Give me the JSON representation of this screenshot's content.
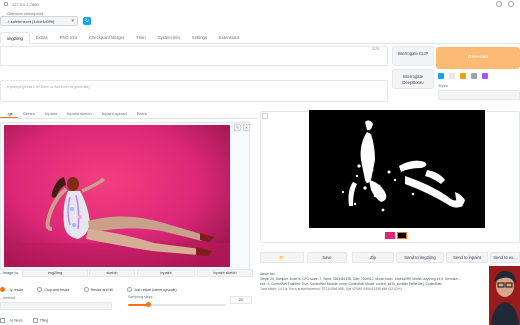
{
  "browser": {
    "url": "127.0.0.1:7860"
  },
  "checkpoint": {
    "label": "...Diffusion checkpoint",
    "value": "...t.safetensors [1dce4d0f9f]"
  },
  "tabs": [
    {
      "label": "img2img",
      "active": true
    },
    {
      "label": "Extras"
    },
    {
      "label": "PNG Info"
    },
    {
      "label": "Checkpoint Merger"
    },
    {
      "label": "Train"
    },
    {
      "label": "System Info"
    },
    {
      "label": "Settings"
    },
    {
      "label": "Extensions"
    }
  ],
  "prompt": {
    "counter": "2/75"
  },
  "negative_prompt": {
    "placeholder": "...e prompt (press Ctrl+Enter or Alt+Enter to generate)"
  },
  "buttons": {
    "interrogate_clip": "Interrogate CLIP",
    "interrogate_deepbooru": "Interrogate DeepBooru",
    "generate": "Generate"
  },
  "styles_label": "Styles",
  "subtabs": [
    {
      "label": "...ge"
    },
    {
      "label": "Sketch"
    },
    {
      "label": "Inpaint"
    },
    {
      "label": "Inpaint sketch"
    },
    {
      "label": "Inpaint upload"
    },
    {
      "label": "Batch"
    }
  ],
  "copy": {
    "label": "...image to:",
    "buttons": [
      "img2img",
      "sketch",
      "inpaint",
      "inpaint sketch"
    ]
  },
  "resize": {
    "options": [
      "...ly resize",
      "Crop and resize",
      "Resize and fill",
      "Just resize (latent upscale)"
    ]
  },
  "sampling": {
    "method_label": "...method",
    "steps_label": "Sampling steps",
    "steps_value": "20",
    "steps_fraction": 0.2
  },
  "restore": {
    "faces": "...re faces",
    "tiling": "Tiling"
  },
  "output": {
    "buttons": [
      "📁",
      "Save",
      "Zip",
      "Send to img2img",
      "Send to inpaint",
      "Send to ex..."
    ],
    "info_prompt": "dance fun",
    "info_params": "Steps: 20, Sampler: Euler a, CFG scale: 7, Seed: 3263481198, Size: 702x512, Model hash: 1dce4d0f9f, Model: anything-v4.5, Denoisin...",
    "info_params2": "blur: 4, ControlNet Enabled: True, ControlNet Module: none, ControlNet Model: control_sd15_scribble [fef5e48e], ControlNet...",
    "timing": "Time taken: 14.11s  Torch active/reserved: 3723/4546 MiB, Sys VRAM: 6456/12288 MiB (52.53%)"
  },
  "colors": {
    "accent": "#f97316",
    "generate_bg": "#fdba74",
    "photo_bg": "#e11d74",
    "mask_bg": "#000000"
  }
}
